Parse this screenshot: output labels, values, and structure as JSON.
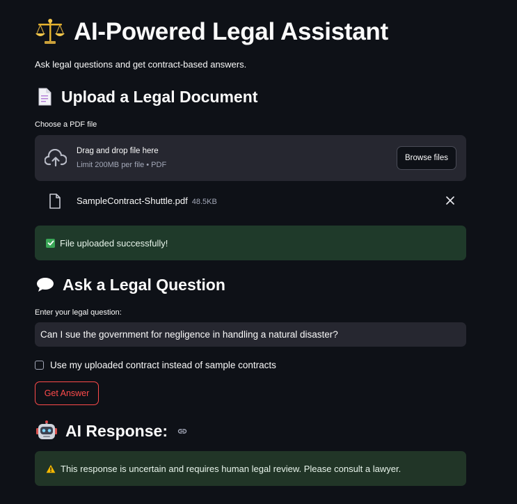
{
  "header": {
    "title": "AI-Powered Legal Assistant",
    "subtitle": "Ask legal questions and get contract-based answers."
  },
  "upload_section": {
    "heading": "Upload a Legal Document",
    "file_label": "Choose a PDF file",
    "dropzone_main": "Drag and drop file here",
    "dropzone_sub": "Limit 200MB per file • PDF",
    "browse_label": "Browse files",
    "uploaded_file": {
      "name": "SampleContract-Shuttle.pdf",
      "size": "48.5KB"
    },
    "success_message": "File uploaded successfully!"
  },
  "question_section": {
    "heading": "Ask a Legal Question",
    "input_label": "Enter your legal question:",
    "input_value": "Can I sue the government for negligence in handling a natural disaster?",
    "checkbox_label": "Use my uploaded contract instead of sample contracts",
    "checkbox_checked": false,
    "button_label": "Get Answer"
  },
  "response_section": {
    "heading": "AI Response:",
    "warning_message": "This response is uncertain and requires human legal review. Please consult a lawyer."
  },
  "colors": {
    "background": "#0e1117",
    "surface": "#262730",
    "primary": "#ff4b4b",
    "success_bg": "#1f3a2a",
    "success_check": "#3aa657",
    "warning_icon": "#f5b800"
  },
  "icons": [
    "scales-icon",
    "document-icon",
    "speech-bubble-icon",
    "robot-icon",
    "cloud-upload-icon",
    "file-icon",
    "close-icon",
    "check-icon",
    "warning-icon",
    "link-icon"
  ]
}
